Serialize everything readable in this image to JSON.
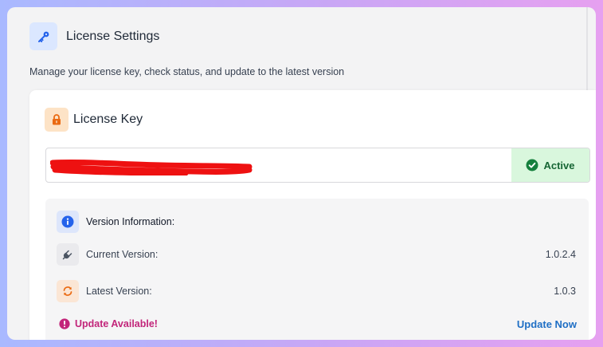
{
  "page": {
    "title": "License Settings",
    "subtitle": "Manage your license key, check status, and update to the latest version",
    "header_icon": "key-icon"
  },
  "license": {
    "title": "License Key",
    "icon": "lock-icon",
    "key_value": "",
    "status": "Active",
    "status_icon": "check-circle-icon",
    "status_color": "#166534"
  },
  "version_info": {
    "title": "Version Information:",
    "icon": "info-icon",
    "current": {
      "label": "Current Version:",
      "value": "1.0.2.4",
      "icon": "plug-icon"
    },
    "latest": {
      "label": "Latest Version:",
      "value": "1.0.3",
      "icon": "refresh-icon"
    },
    "update_notice": "Update Available!",
    "update_icon": "alert-circle-icon",
    "update_action": "Update Now",
    "accent_color": "#1f6fc5",
    "alert_color": "#c2257a"
  }
}
